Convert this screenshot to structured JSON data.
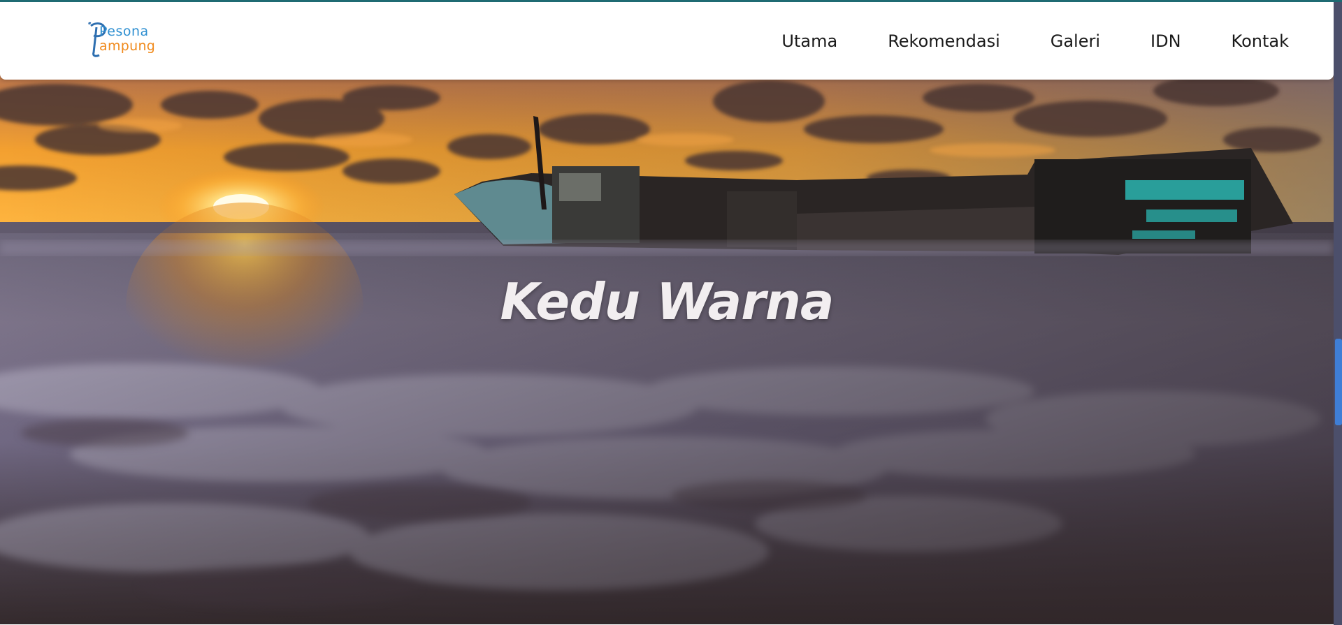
{
  "logo": {
    "line1": "Pesona",
    "line2": "ampung"
  },
  "nav": {
    "items": [
      "Utama",
      "Rekomendasi",
      "Galeri",
      "IDN",
      "Kontak"
    ]
  },
  "hero": {
    "title": "Kedu Warna"
  },
  "colors": {
    "accent": "#1f6b73",
    "logo_blue": "#2e8fd1",
    "logo_orange": "#f08a1c",
    "scrollbar": "#4c4f6b",
    "scroll_thumb": "#3f7ed6"
  }
}
